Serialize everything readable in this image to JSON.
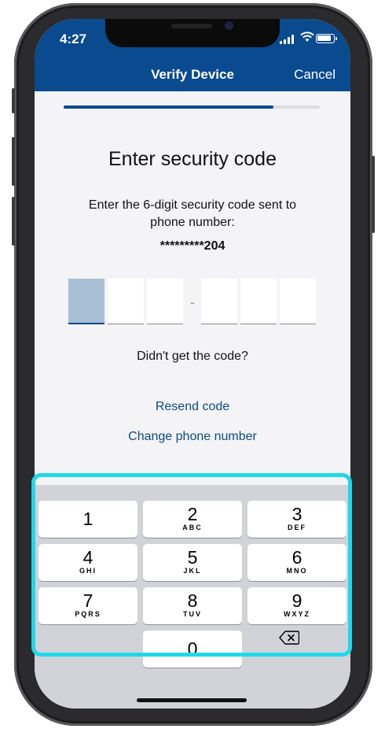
{
  "status_bar": {
    "time": "4:27"
  },
  "nav": {
    "title": "Verify Device",
    "cancel_label": "Cancel"
  },
  "progress": {
    "fraction": 0.82
  },
  "main": {
    "heading": "Enter security code",
    "instruction": "Enter the 6-digit security code sent to phone number:",
    "masked_phone": "*********204",
    "code_digits": [
      "",
      "",
      "",
      "",
      "",
      ""
    ],
    "code_separator": "-",
    "no_code_prompt": "Didn't get the code?",
    "resend_label": "Resend code",
    "change_phone_label": "Change phone number"
  },
  "keypad": {
    "keys": [
      {
        "digit": "1",
        "letters": ""
      },
      {
        "digit": "2",
        "letters": "ABC"
      },
      {
        "digit": "3",
        "letters": "DEF"
      },
      {
        "digit": "4",
        "letters": "GHI"
      },
      {
        "digit": "5",
        "letters": "JKL"
      },
      {
        "digit": "6",
        "letters": "MNO"
      },
      {
        "digit": "7",
        "letters": "PQRS"
      },
      {
        "digit": "8",
        "letters": "TUV"
      },
      {
        "digit": "9",
        "letters": "WXYZ"
      },
      {
        "digit": "0",
        "letters": ""
      }
    ],
    "backspace_icon": "backspace-icon"
  },
  "colors": {
    "brand_blue": "#0a4a8f",
    "highlight": "#1fd8ec",
    "active_box": "#a7bed4"
  }
}
